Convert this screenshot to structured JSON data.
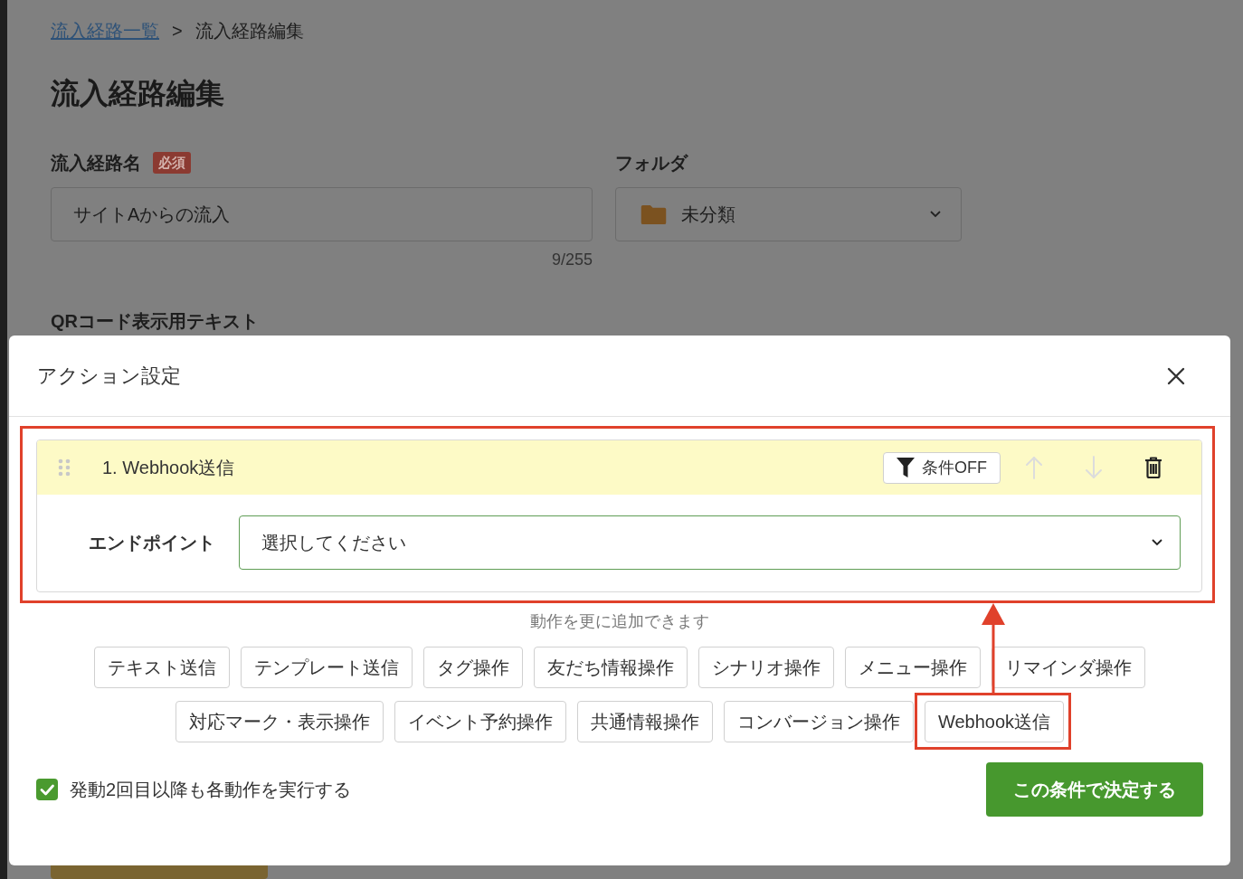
{
  "page": {
    "breadcrumb": {
      "items": [
        {
          "label": "流入経路一覧",
          "link": true
        },
        {
          "label": "流入経路編集",
          "link": false
        }
      ],
      "separator": ">"
    },
    "title": "流入経路編集",
    "name_field": {
      "label": "流入経路名",
      "badge": "必須",
      "value": "サイトAからの流入",
      "counter": "9/255"
    },
    "folder_field": {
      "label": "フォルダ",
      "value": "未分類"
    },
    "qr_text_label": "QRコード表示用テキスト"
  },
  "modal": {
    "title": "アクション設定",
    "actions": [
      {
        "title": "1. Webhook送信",
        "highlighted": true,
        "condition_button": "条件OFF",
        "up_disabled": true,
        "down_disabled": true,
        "field_label": "エンドポイント",
        "placeholder": "選択してください"
      }
    ],
    "add_hint": "動作を更に追加できます",
    "add_buttons": [
      {
        "label": "テキスト送信",
        "highlighted": false
      },
      {
        "label": "テンプレート送信",
        "highlighted": false
      },
      {
        "label": "タグ操作",
        "highlighted": false
      },
      {
        "label": "友だち情報操作",
        "highlighted": false
      },
      {
        "label": "シナリオ操作",
        "highlighted": false
      },
      {
        "label": "メニュー操作",
        "highlighted": false
      },
      {
        "label": "リマインダ操作",
        "highlighted": false
      },
      {
        "label": "対応マーク・表示操作",
        "highlighted": false
      },
      {
        "label": "イベント予約操作",
        "highlighted": false
      },
      {
        "label": "共通情報操作",
        "highlighted": false
      },
      {
        "label": "コンバージョン操作",
        "highlighted": false
      },
      {
        "label": "Webhook送信",
        "highlighted": true
      }
    ],
    "repeat_checkbox": {
      "label": "発動2回目以降も各動作を実行する",
      "checked": true
    },
    "submit": "この条件で決定する"
  }
}
